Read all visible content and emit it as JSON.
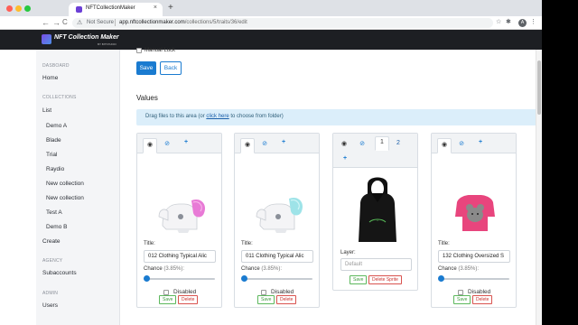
{
  "browser": {
    "tab_title": "NFTCollectionMaker",
    "tab_close": "×",
    "new_tab": "+",
    "tab_overflow": "⌄",
    "nav_back": "←",
    "nav_forward": "→",
    "nav_reload": "C",
    "security": "Not Secure",
    "url_host": "app.nftcollectionmaker.com",
    "url_path": "/collections/5/traits/36/edit",
    "avatar_letter": "A"
  },
  "app": {
    "logo_text": "NFT Collection Maker",
    "logo_sub": "BY BITSTUDIO"
  },
  "sidebar": {
    "sections": [
      {
        "heading": "DASBOARD",
        "items": [
          "Home"
        ]
      },
      {
        "heading": "COLLECTIONS",
        "items": [
          "List"
        ],
        "sub_items": [
          "Demo A",
          "Blade",
          "Trial",
          "Raydio",
          "New collection",
          "New collection",
          "Test A",
          "Demo B"
        ],
        "after": [
          "Create"
        ]
      },
      {
        "heading": "AGENCY",
        "items": [
          "Subaccounts"
        ]
      },
      {
        "heading": "ADMIN",
        "items": [
          "Users"
        ]
      }
    ]
  },
  "main": {
    "manual_luck_label": "Manual Luck",
    "save_button": "Save",
    "back_button": "Back",
    "values_title": "Values",
    "dropzone_before": "Drag files to this area (or ",
    "dropzone_link": "click here",
    "dropzone_after": " to choose from folder)"
  },
  "cards": [
    {
      "tabs": [
        "+"
      ],
      "title_label": "Title:",
      "title_value": "012 Clothing Typical Alic",
      "chance_label": "Chance",
      "chance_pct": "(3.85%):",
      "chance_value": 0.0385,
      "disabled_label": "Disabled",
      "save": "Save",
      "delete": "Delete"
    },
    {
      "tabs": [
        "+"
      ],
      "title_label": "Title:",
      "title_value": "011 Clothing Typical Alic",
      "chance_label": "Chance",
      "chance_pct": "(3.85%):",
      "chance_value": 0.0385,
      "disabled_label": "Disabled",
      "save": "Save",
      "delete": "Delete"
    },
    {
      "tabs": [
        "1",
        "2",
        "+"
      ],
      "layer_label": "Layer:",
      "layer_placeholder": "Default",
      "save": "Save",
      "delete": "Delete Sprite"
    },
    {
      "tabs": [
        "+"
      ],
      "title_label": "Title:",
      "title_value": "132 Clothing Oversized S",
      "chance_label": "Chance",
      "chance_pct": "(3.85%):",
      "chance_value": 0.0385,
      "disabled_label": "Disabled",
      "save": "Save",
      "delete": "Delete"
    }
  ],
  "colors": {
    "primary": "#1a7bd0",
    "header_bg": "#1d1f23",
    "save_green": "#5cb85c",
    "delete_red": "#d9534f"
  }
}
